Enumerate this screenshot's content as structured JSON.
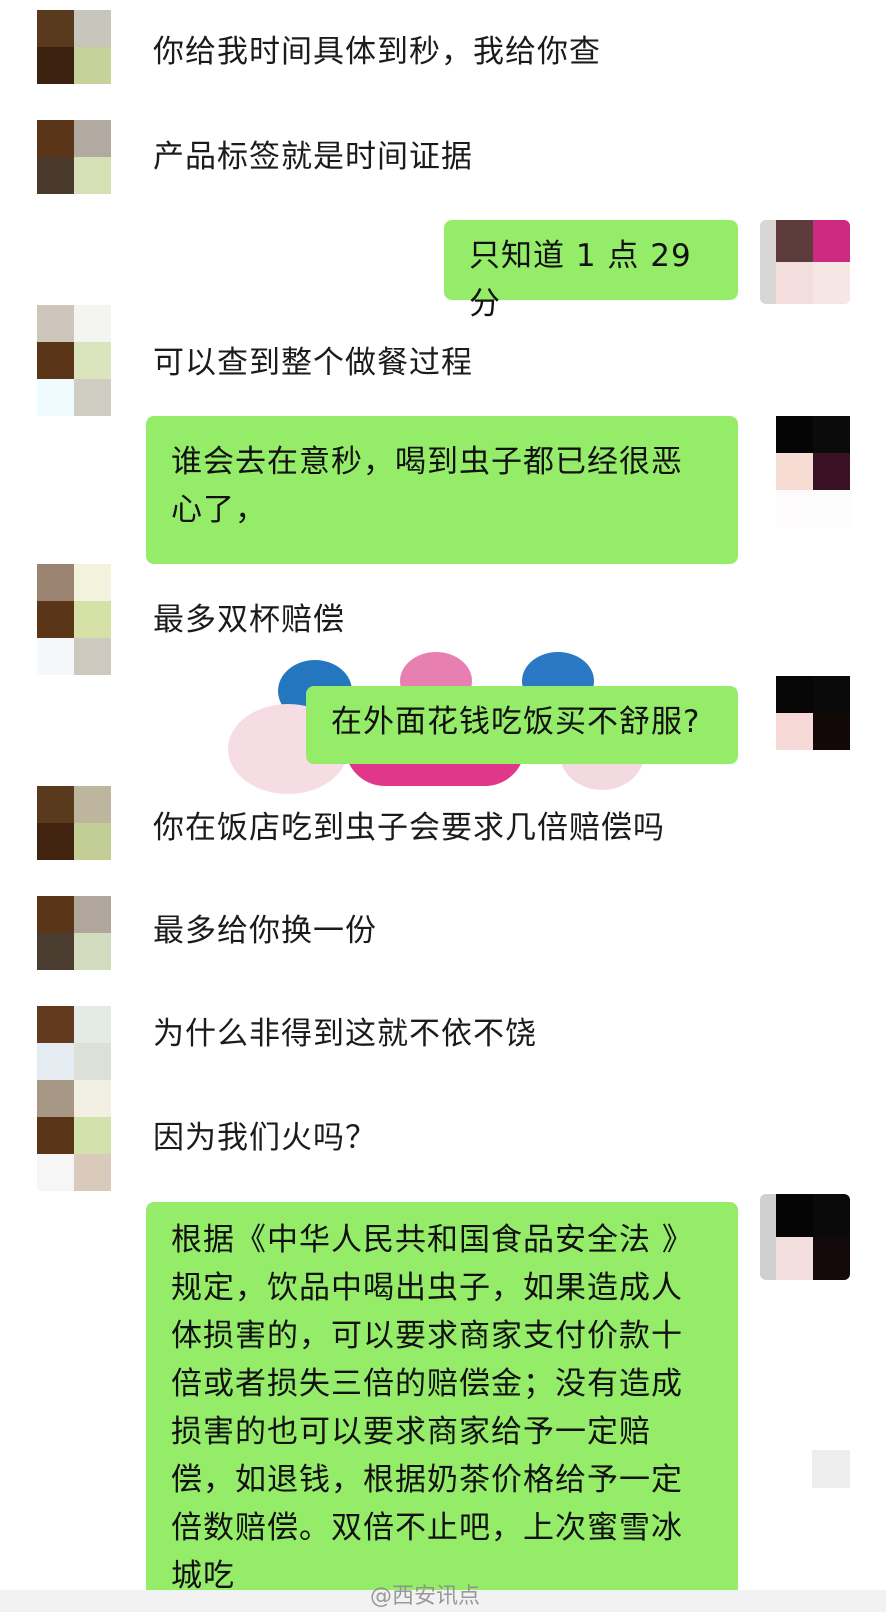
{
  "messages": [
    {
      "side": "left",
      "text": "你给我时间具体到秒，我给你查"
    },
    {
      "side": "left",
      "text": "产品标签就是时间证据"
    },
    {
      "side": "right",
      "text": "只知道 1 点 29 分"
    },
    {
      "side": "left",
      "text": "可以查到整个做餐过程"
    },
    {
      "side": "right",
      "text": "谁会去在意秒，喝到虫子都已经很恶心了，"
    },
    {
      "side": "left",
      "text": "最多双杯赔偿"
    },
    {
      "side": "right",
      "text": "在外面花钱吃饭买不舒服?"
    },
    {
      "side": "left",
      "text": "你在饭店吃到虫子会要求几倍赔偿吗"
    },
    {
      "side": "left",
      "text": "最多给你换一份"
    },
    {
      "side": "left",
      "text": "为什么非得到这就不依不饶"
    },
    {
      "side": "left",
      "text": "因为我们火吗？"
    },
    {
      "side": "right",
      "text": "根据《中华人民共和国食品安全法 》规定，饮品中喝出虫子，如果造成人体损害的，可以要求商家支付价款十倍或者损失三倍的赔偿金；没有造成损害的也可以要求商家给予一定赔偿，如退钱，根据奶茶价格给予一定倍数赔偿。双倍不止吧，上次蜜雪冰城吃"
    }
  ],
  "watermark": "@西安讯点",
  "colors": {
    "bubble_green": "#95ec69",
    "background": "#ffffff"
  }
}
